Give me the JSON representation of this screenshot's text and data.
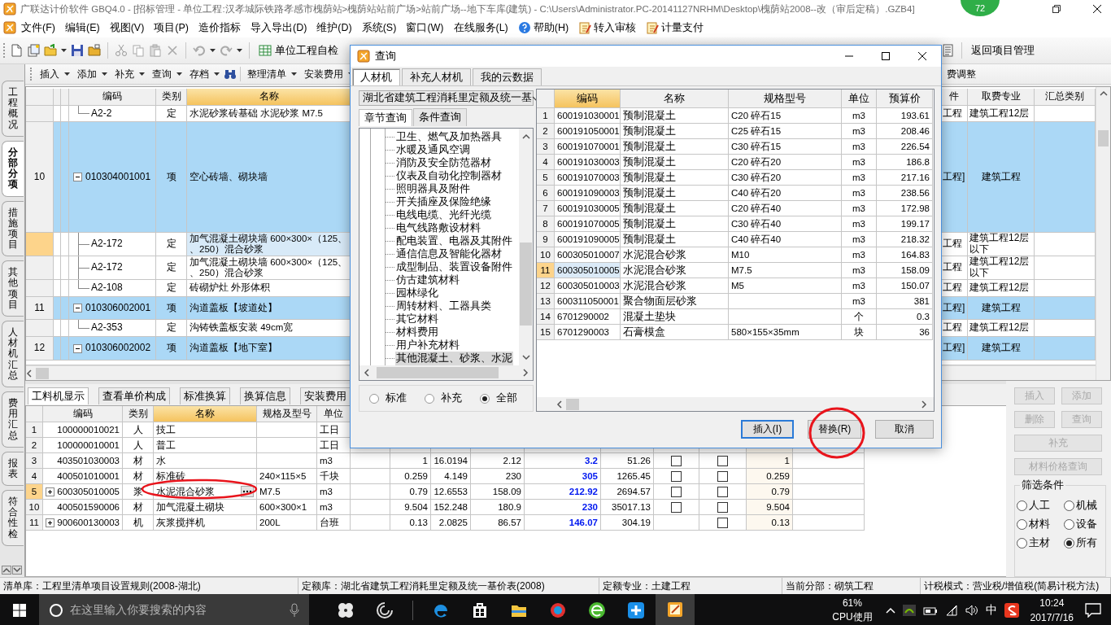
{
  "window": {
    "title": "广联达计价软件 GBQ4.0 - [招标管理 - 单位工程:汉孝城际铁路孝感市槐荫站>槐荫站站前广场>站前广场--地下车库(建筑) - C:\\Users\\Administrator.PC-20141127NRHM\\Desktop\\槐荫站2008--改（审后定稿）.GZB4]",
    "badge": "72"
  },
  "menu": [
    {
      "label": "文件(F)",
      "kind": "text"
    },
    {
      "label": "编辑(E)",
      "kind": "text"
    },
    {
      "label": "视图(V)",
      "kind": "text"
    },
    {
      "label": "项目(P)",
      "kind": "text"
    },
    {
      "label": "造价指标",
      "kind": "text"
    },
    {
      "label": "导入导出(D)",
      "kind": "text"
    },
    {
      "label": "维护(D)",
      "kind": "text"
    },
    {
      "label": "系统(S)",
      "kind": "text"
    },
    {
      "label": "窗口(W)",
      "kind": "text"
    },
    {
      "label": "在线服务(L)",
      "kind": "text"
    },
    {
      "label": "帮助(H)",
      "kind": "help"
    },
    {
      "label": "转入审核",
      "kind": "document"
    },
    {
      "label": "计量支付",
      "kind": "document"
    }
  ],
  "toolbar": {
    "self_check": "单位工程自检",
    "return": "返回项目管理"
  },
  "sub_toolbar": {
    "items": [
      "插入",
      "添加",
      "补充",
      "查询",
      "存档"
    ],
    "more_items": [
      "整理清单",
      "安装费用"
    ],
    "cut_item": "费调整"
  },
  "side_tabs": [
    {
      "label": "工程概况",
      "selected": false
    },
    {
      "label": "分部分项",
      "selected": true
    },
    {
      "label": "措施项目",
      "selected": false
    },
    {
      "label": "其他项目",
      "selected": false
    },
    {
      "label": "人材机汇总",
      "selected": false
    },
    {
      "label": "费用汇总",
      "selected": false
    },
    {
      "label": "报表",
      "selected": false
    },
    {
      "label": "符合性检",
      "selected": false
    }
  ],
  "bill_table": {
    "columns": [
      {
        "label": "编码",
        "selected": false
      },
      {
        "label": "类别",
        "selected": false
      },
      {
        "label": "名称",
        "selected": true
      },
      {
        "label": "件",
        "selected": false
      },
      {
        "label": "取费专业",
        "selected": false
      },
      {
        "label": "汇总类别",
        "selected": false
      }
    ],
    "rows": [
      {
        "kind": "quota",
        "code": "A2-2",
        "type": "定",
        "name": "水泥砂浆砖基础 水泥砂浆 M7.5",
        "column_4": "工程",
        "fee": "建筑工程12层",
        "selected": false
      },
      {
        "kind": "item",
        "number": "10",
        "code": "010304001001",
        "type": "项",
        "name": "空心砖墙、砌块墙",
        "column_4": "工程]",
        "fee": "建筑工程",
        "selected": false,
        "expanded": true,
        "children": [
          {
            "kind": "quota",
            "code": "A2-172",
            "type": "定",
            "name": [
              "加气混凝土砌块墙 600×300×（125、",
              "、250）混合砂浆"
            ],
            "column_4": "工程",
            "fee": [
              "建筑工程12层",
              "以下"
            ],
            "selected": true
          },
          {
            "kind": "quota",
            "code": "A2-172",
            "type": "定",
            "name": [
              "加气混凝土砌块墙 600×300×（125、",
              "、250）混合砂浆"
            ],
            "column_4": "工程",
            "fee": [
              "建筑工程12层",
              "以下"
            ],
            "selected": false
          },
          {
            "kind": "quota",
            "code": "A2-108",
            "type": "定",
            "name": "砖砌炉灶 外形体积",
            "column_4": "工程",
            "fee": "建筑工程12层",
            "selected": false
          }
        ]
      },
      {
        "kind": "item",
        "number": "11",
        "code": "010306002001",
        "type": "项",
        "name": "沟道盖板【坡道处】",
        "column_4": "工程]",
        "fee": "建筑工程",
        "selected": false,
        "expanded": true,
        "children": [
          {
            "kind": "quota",
            "code": "A2-353",
            "type": "定",
            "name": "沟铸铁盖板安装 49cm宽",
            "column_4": "工程",
            "fee": "建筑工程12层",
            "selected": false
          }
        ]
      },
      {
        "kind": "item",
        "number": "12",
        "code": "010306002002",
        "type": "项",
        "name": "沟道盖板【地下室】",
        "column_4": "工程]",
        "fee": "建筑工程",
        "selected": false,
        "expanded": true
      }
    ]
  },
  "lower_tabs": [
    {
      "label": "工料机显示",
      "selected": true
    },
    {
      "label": "查看单价构成",
      "selected": false
    },
    {
      "label": "标准换算",
      "selected": false
    },
    {
      "label": "换算信息",
      "selected": false
    },
    {
      "label": "安装费用",
      "selected": false
    }
  ],
  "resource_table": {
    "columns": [
      {
        "label": "编码",
        "selected": false
      },
      {
        "label": "类别",
        "selected": false
      },
      {
        "label": "名称",
        "selected": true
      },
      {
        "label": "规格及型号",
        "selected": false
      },
      {
        "label": "单位",
        "selected": false
      }
    ],
    "rows": [
      {
        "number": "1",
        "code": "100000010021",
        "type": "人",
        "name": "技工",
        "unit": "工日",
        "selected": false,
        "editing": false
      },
      {
        "number": "2",
        "code": "100000010001",
        "type": "人",
        "name": "普工",
        "unit": "工日",
        "selected": false,
        "editing": false
      },
      {
        "number": "3",
        "code": "403501030003",
        "type": "材",
        "name": "水",
        "unit": "m3",
        "figures": [
          "1",
          "16.0194",
          "2.12",
          "3.2",
          "51.26"
        ],
        "check_1": false,
        "check_2": false,
        "column_15": "1",
        "selected": false,
        "editing": false
      },
      {
        "number": "4",
        "code": "400501010001",
        "type": "材",
        "name": "标准砖",
        "spec": "240×115×5",
        "unit": "千块",
        "figures": [
          "0.259",
          "4.149",
          "230",
          "305",
          "1265.45"
        ],
        "check_1": false,
        "check_2": false,
        "column_15": "0.259",
        "selected": false,
        "editing": false
      },
      {
        "number": "5",
        "code": "600305010005",
        "type": "浆",
        "name": "水泥混合砂浆",
        "spec": "M7.5",
        "unit": "m3",
        "figures": [
          "0.79",
          "12.6553",
          "158.09",
          "212.92",
          "2694.57"
        ],
        "check_1": false,
        "check_2": false,
        "column_15": "0.79",
        "selected": true,
        "editing": true,
        "expanded": false
      },
      {
        "number": "10",
        "code": "400501590006",
        "type": "材",
        "name": "加气混凝土砌块",
        "spec": "600×300×1",
        "unit": "m3",
        "figures": [
          "9.504",
          "152.248",
          "180.9",
          "230",
          "35017.13"
        ],
        "check_1": false,
        "check_2": false,
        "column_15": "9.504",
        "selected": false,
        "editing": false
      },
      {
        "number": "11",
        "code": "900600130003",
        "type": "机",
        "name": "灰浆搅拌机",
        "spec": "200L",
        "unit": "台班",
        "figures": [
          "0.13",
          "2.0825",
          "86.57",
          "146.07",
          "304.19"
        ],
        "check_2": false,
        "column_15": "0.13",
        "selected": false,
        "editing": false,
        "expanded": false
      }
    ]
  },
  "side_buttons": [
    {
      "label": "插入",
      "disabled": true,
      "wide": false
    },
    {
      "label": "添加",
      "disabled": true,
      "wide": false
    },
    {
      "label": "删除",
      "disabled": true,
      "wide": false
    },
    {
      "label": "查询",
      "disabled": true,
      "wide": false
    },
    {
      "label": "补充",
      "disabled": true,
      "wide": true
    },
    {
      "label": "材料价格查询",
      "disabled": true,
      "wide": true
    }
  ],
  "filter": {
    "title": "筛选条件",
    "options": [
      {
        "label": "人工",
        "selected": false
      },
      {
        "label": "机械",
        "selected": false
      },
      {
        "label": "材料",
        "selected": false
      },
      {
        "label": "设备",
        "selected": false
      },
      {
        "label": "主材",
        "selected": false
      },
      {
        "label": "所有",
        "selected": true
      }
    ]
  },
  "status_bar": [
    "清单库：工程里清单项目设置规则(2008-湖北)",
    "定额库：湖北省建筑工程消耗里定额及统一基价表(2008)",
    "定额专业：土建工程",
    "当前分部：砌筑工程",
    "计税模式：营业税/增值税(简易计税方法)"
  ],
  "dialog": {
    "title": "查询",
    "tabs": [
      {
        "label": "人材机",
        "selected": true
      },
      {
        "label": "补充人材机",
        "selected": false
      },
      {
        "label": "我的云数据",
        "selected": false
      }
    ],
    "library": "湖北省建筑工程消耗里定额及统一基",
    "search_tabs": [
      {
        "label": "章节查询",
        "selected": true
      },
      {
        "label": "条件查询",
        "selected": false
      }
    ],
    "tree": [
      {
        "label": "卫生、燃气及加热器具",
        "selected": false
      },
      {
        "label": "水暖及通风空调",
        "selected": false
      },
      {
        "label": "消防及安全防范器材",
        "selected": false
      },
      {
        "label": "仪表及自动化控制器材",
        "selected": false
      },
      {
        "label": "照明器具及附件",
        "selected": false
      },
      {
        "label": "开关插座及保险绝缘",
        "selected": false
      },
      {
        "label": "电线电缆、光纤光缆",
        "selected": false
      },
      {
        "label": "电气线路敷设材料",
        "selected": false
      },
      {
        "label": "配电装置、电器及其附件",
        "selected": false
      },
      {
        "label": "通信信息及智能化器材",
        "selected": false
      },
      {
        "label": "成型制品、装置设备附件",
        "selected": false
      },
      {
        "label": "仿古建筑材料",
        "selected": false
      },
      {
        "label": "园林绿化",
        "selected": false
      },
      {
        "label": "周转材料、工器具类",
        "selected": false
      },
      {
        "label": "其它材料",
        "selected": false
      },
      {
        "label": "材料费用",
        "selected": false
      },
      {
        "label": "用户补充材料",
        "selected": false
      },
      {
        "label": "其他混凝土、砂浆、水泥",
        "selected": true
      }
    ],
    "scope": [
      {
        "label": "标准",
        "selected": false
      },
      {
        "label": "补充",
        "selected": false
      },
      {
        "label": "全部",
        "selected": true
      }
    ],
    "table": {
      "columns": [
        {
          "label": "编码",
          "selected": true
        },
        {
          "label": "名称",
          "selected": false
        },
        {
          "label": "规格型号",
          "selected": false
        },
        {
          "label": "单位",
          "selected": false
        },
        {
          "label": "预算价",
          "selected": false
        }
      ],
      "rows": [
        {
          "number": "1",
          "code": "600191030001",
          "name": "预制混凝土",
          "spec": "C20 碎石15",
          "unit": "m3",
          "price": "193.61",
          "selected": false
        },
        {
          "number": "2",
          "code": "600191050001",
          "name": "预制混凝土",
          "spec": "C25 碎石15",
          "unit": "m3",
          "price": "208.46",
          "selected": false
        },
        {
          "number": "3",
          "code": "600191070001",
          "name": "预制混凝土",
          "spec": "C30 碎石15",
          "unit": "m3",
          "price": "226.54",
          "selected": false
        },
        {
          "number": "4",
          "code": "600191030003",
          "name": "预制混凝土",
          "spec": "C20 碎石20",
          "unit": "m3",
          "price": "186.8",
          "selected": false
        },
        {
          "number": "5",
          "code": "600191070003",
          "name": "预制混凝土",
          "spec": "C30 碎石20",
          "unit": "m3",
          "price": "217.16",
          "selected": false
        },
        {
          "number": "6",
          "code": "600191090003",
          "name": "预制混凝土",
          "spec": "C40 碎石20",
          "unit": "m3",
          "price": "238.56",
          "selected": false
        },
        {
          "number": "7",
          "code": "600191030005",
          "name": "预制混凝土",
          "spec": "C20 碎石40",
          "unit": "m3",
          "price": "172.98",
          "selected": false
        },
        {
          "number": "8",
          "code": "600191070005",
          "name": "预制混凝土",
          "spec": "C30 碎石40",
          "unit": "m3",
          "price": "199.17",
          "selected": false
        },
        {
          "number": "9",
          "code": "600191090005",
          "name": "预制混凝土",
          "spec": "C40 碎石40",
          "unit": "m3",
          "price": "218.32",
          "selected": false
        },
        {
          "number": "10",
          "code": "600305010007",
          "name": "水泥混合砂浆",
          "spec": "M10",
          "unit": "m3",
          "price": "164.83",
          "selected": false
        },
        {
          "number": "11",
          "code": "600305010005",
          "name": "水泥混合砂浆",
          "spec": "M7.5",
          "unit": "m3",
          "price": "158.09",
          "selected": true
        },
        {
          "number": "12",
          "code": "600305010003",
          "name": "水泥混合砂浆",
          "spec": "M5",
          "unit": "m3",
          "price": "150.07",
          "selected": false
        },
        {
          "number": "13",
          "code": "600311050001",
          "name": "聚合物面层砂浆",
          "unit": "m3",
          "price": "381",
          "selected": false
        },
        {
          "number": "14",
          "code": "6701290002",
          "name": "混凝土垫块",
          "unit": "个",
          "price": "0.3",
          "selected": false
        },
        {
          "number": "15",
          "code": "6701290003",
          "name": "石膏模盒",
          "spec": "580×155×35mm",
          "unit": "块",
          "price": "36",
          "selected": false
        }
      ]
    },
    "buttons": [
      {
        "label": "插入(I)",
        "default": true
      },
      {
        "label": "替换(R)",
        "default": false
      },
      {
        "label": "取消",
        "default": false
      }
    ]
  },
  "taskbar": {
    "search_placeholder": "在这里输入你要搜索的内容",
    "cpu_percent": "61%",
    "cpu_label": "CPU使用",
    "ime": "中",
    "time": "10:24",
    "date": "2017/7/16"
  }
}
